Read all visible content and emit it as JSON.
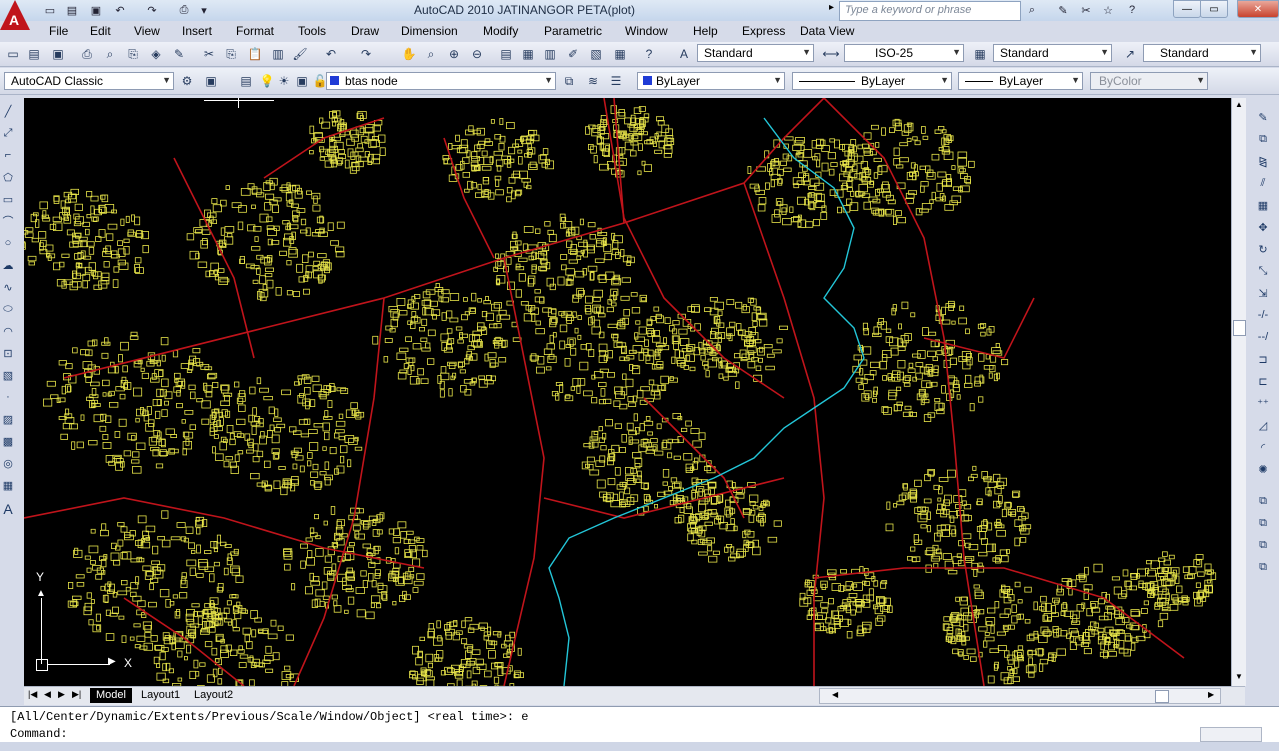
{
  "titlebar": {
    "title": "AutoCAD 2010    JATINANGOR PETA(plot)",
    "search_placeholder": "Type a keyword or phrase",
    "logo": "A"
  },
  "menu": [
    "File",
    "Edit",
    "View",
    "Insert",
    "Format",
    "Tools",
    "Draw",
    "Dimension",
    "Modify",
    "Parametric",
    "Window",
    "Help",
    "Express",
    "Data View"
  ],
  "styles": {
    "text_style": "Standard",
    "dim_style": "ISO-25",
    "table_style": "Standard",
    "mleader_style": "Standard"
  },
  "workspace": "AutoCAD Classic",
  "layer": {
    "name": "btas node",
    "color": "#1f3bd6"
  },
  "properties": {
    "color": "ByLayer",
    "linetype": "ByLayer",
    "lineweight": "ByLayer",
    "plotstyle": "ByColor"
  },
  "tabs": [
    "Model",
    "Layout1",
    "Layout2"
  ],
  "command": {
    "history": "[All/Center/Dynamic/Extents/Previous/Scale/Window/Object] <real time>: e",
    "prompt": "Command:"
  },
  "ucs": {
    "x_label": "X",
    "y_label": "Y"
  },
  "colors": {
    "road": "#c0141b",
    "building": "#e8e54a",
    "river": "#23c6d8",
    "canvas": "#000000"
  }
}
